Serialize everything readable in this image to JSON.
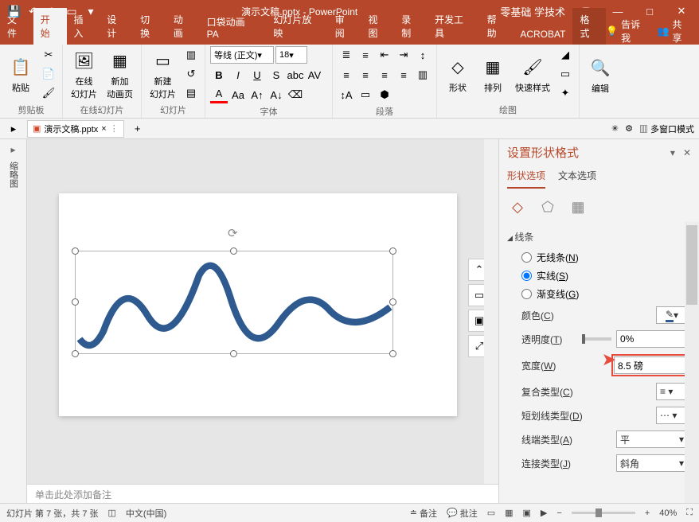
{
  "titlebar": {
    "doc_title": "演示文稿.pptx - PowerPoint",
    "brand": "零基础 学技术"
  },
  "ribbon": {
    "tabs": [
      "文件",
      "开始",
      "插入",
      "设计",
      "切换",
      "动画",
      "口袋动画 PA",
      "幻灯片放映",
      "审阅",
      "视图",
      "录制",
      "开发工具",
      "帮助",
      "ACROBAT",
      "格式"
    ],
    "tell_me": "告诉我",
    "share": "共享",
    "groups": {
      "clipboard": "剪贴板",
      "paste": "粘贴",
      "online_slides": "在线幻灯片",
      "online_slide_btn": "在线\n幻灯片",
      "new_anim_btn": "新加\n动画页",
      "slides": "幻灯片",
      "new_slide": "新建\n幻灯片",
      "font": "字体",
      "font_name": "等线 (正文)",
      "font_size": "18",
      "paragraph": "段落",
      "drawing": "绘图",
      "shapes": "形状",
      "arrange": "排列",
      "quick_styles": "快速样式",
      "editing": "编辑"
    }
  },
  "docbar": {
    "tab_label": "演示文稿.pptx",
    "multi_window": "多窗口模式"
  },
  "thumb": {
    "label": "缩略图"
  },
  "notes": {
    "placeholder": "单击此处添加备注"
  },
  "rightpane": {
    "title": "设置形状格式",
    "tab_shape": "形状选项",
    "tab_text": "文本选项",
    "section_line": "线条",
    "radio_none": "无线条",
    "radio_none_key": "N",
    "radio_solid": "实线",
    "radio_solid_key": "S",
    "radio_gradient": "渐变线",
    "radio_gradient_key": "G",
    "color_label": "颜色",
    "color_key": "C",
    "transparency_label": "透明度",
    "transparency_key": "T",
    "transparency_value": "0%",
    "width_label": "宽度",
    "width_key": "W",
    "width_value": "8.5 磅",
    "compound_label": "复合类型",
    "compound_key": "C",
    "dash_label": "短划线类型",
    "dash_key": "D",
    "cap_label": "线端类型",
    "cap_key": "A",
    "cap_value": "平",
    "join_label": "连接类型",
    "join_key": "J",
    "join_value": "斜角"
  },
  "statusbar": {
    "slide_info": "幻灯片 第 7 张，共 7 张",
    "language": "中文(中国)",
    "notes": "备注",
    "comments": "批注",
    "zoom": "40%"
  }
}
